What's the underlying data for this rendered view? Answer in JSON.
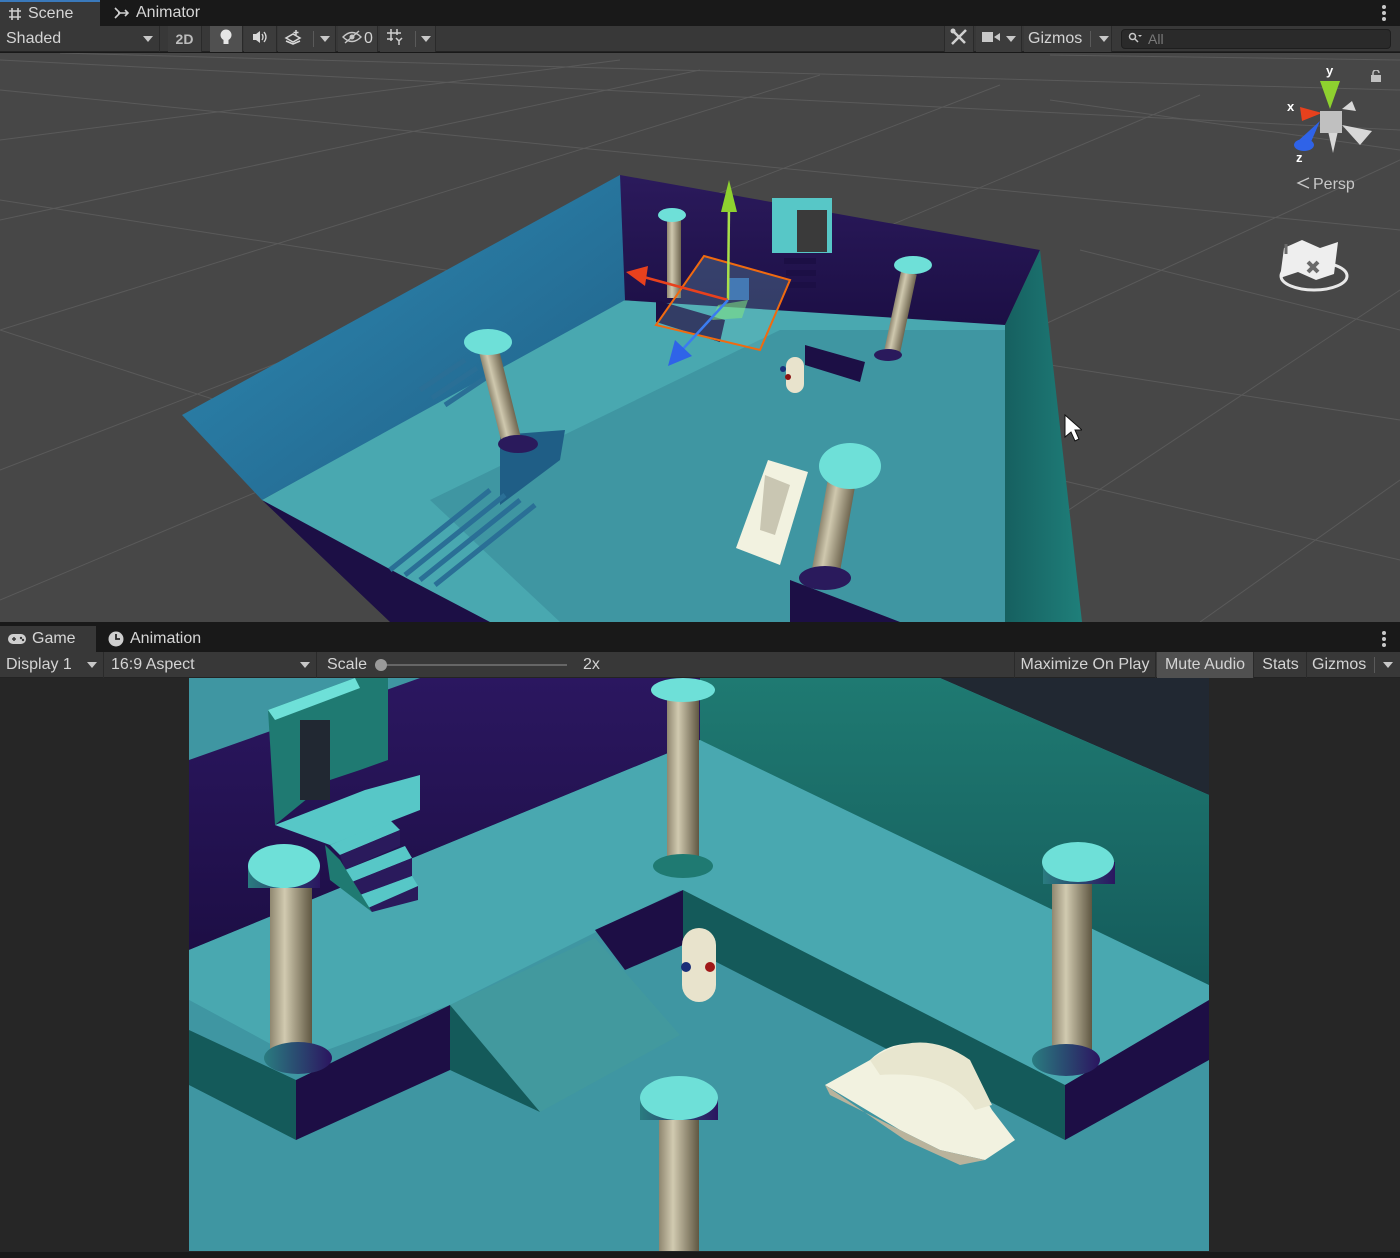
{
  "scene_panel": {
    "tabs": [
      {
        "label": "Scene",
        "icon": "grid-hash-icon",
        "active": true
      },
      {
        "label": "Animator",
        "icon": "animator-arrow-icon",
        "active": false
      }
    ],
    "toolbar": {
      "draw_mode": "Shaded",
      "mode_2d_label": "2D",
      "lighting_icon": "lightbulb-icon",
      "audio_icon": "speaker-icon",
      "effects_icon": "effects-layers-icon",
      "hidden_count": "0",
      "grid_icon": "grid-snap-icon",
      "tools_icon": "wrench-tools-icon",
      "camera_icon": "camera-icon",
      "gizmos_label": "Gizmos",
      "search_placeholder": "All"
    },
    "orientation_gizmo": {
      "axes": {
        "x": "x",
        "y": "y",
        "z": "z"
      },
      "projection_label": "Persp",
      "colors": {
        "x": "#e8411d",
        "y": "#8ed12f",
        "z": "#2f63e8",
        "neutral": "#d8d8d8"
      }
    },
    "selection_colors": {
      "outline": "#f06a10",
      "scene_wall": "#24104a",
      "floor": "#49a8b0",
      "left_wall": "#2a7aa3",
      "right_wall": "#1a6f70",
      "pillar_top": "#6ee0d8",
      "pillar": "#b1a98e",
      "grid_background": "#474747"
    }
  },
  "game_panel": {
    "tabs": [
      {
        "label": "Game",
        "icon": "gamepad-icon",
        "active": true
      },
      {
        "label": "Animation",
        "icon": "clock-icon",
        "active": false
      }
    ],
    "toolbar": {
      "display_label": "Display 1",
      "aspect_label": "16:9 Aspect",
      "scale_label": "Scale",
      "scale_value": "2x",
      "scale_slider_fraction": 0.0,
      "maximize_label": "Maximize On Play",
      "mute_label": "Mute Audio",
      "mute_active": true,
      "stats_label": "Stats",
      "gizmos_label": "Gizmos"
    }
  }
}
